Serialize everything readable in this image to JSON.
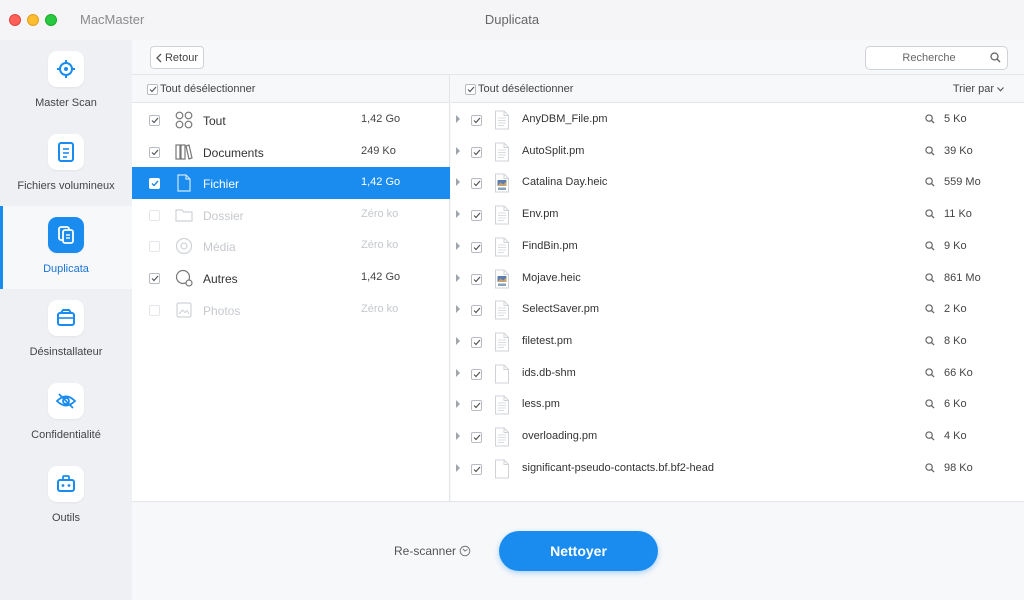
{
  "window": {
    "app_name": "MacMaster",
    "title": "Duplicata"
  },
  "colors": {
    "accent": "#1a8cf0",
    "sidebar_bg": "#eef0f4",
    "traffic_red": "#fe5f57",
    "traffic_yellow": "#febc2e",
    "traffic_green": "#28c840"
  },
  "sidebar": {
    "items": [
      {
        "label": "Master Scan",
        "icon": "target-icon",
        "active": false
      },
      {
        "label": "Fichiers volumineux",
        "icon": "document-icon",
        "active": false
      },
      {
        "label": "Duplicata",
        "icon": "copy-icon",
        "active": true
      },
      {
        "label": "Désinstallateur",
        "icon": "box-icon",
        "active": false
      },
      {
        "label": "Confidentialité",
        "icon": "eye-slash-icon",
        "active": false
      },
      {
        "label": "Outils",
        "icon": "toolbox-icon",
        "active": false
      }
    ]
  },
  "toolbar": {
    "back_label": "Retour",
    "search_placeholder": "Recherche"
  },
  "left_panel": {
    "header_label": "Tout désélectionner",
    "categories": [
      {
        "label": "Tout",
        "size": "1,42 Go",
        "checked": true,
        "enabled": true,
        "active": false,
        "icon": "grid-icon"
      },
      {
        "label": "Documents",
        "size": "249 Ko",
        "checked": true,
        "enabled": true,
        "active": false,
        "icon": "books-icon"
      },
      {
        "label": "Fichier",
        "size": "1,42 Go",
        "checked": true,
        "enabled": true,
        "active": true,
        "icon": "file-icon"
      },
      {
        "label": "Dossier",
        "size": "Zéro ko",
        "checked": false,
        "enabled": false,
        "active": false,
        "icon": "folder-icon"
      },
      {
        "label": "Média",
        "size": "Zéro ko",
        "checked": false,
        "enabled": false,
        "active": false,
        "icon": "media-icon"
      },
      {
        "label": "Autres",
        "size": "1,42 Go",
        "checked": true,
        "enabled": true,
        "active": false,
        "icon": "others-icon"
      },
      {
        "label": "Photos",
        "size": "Zéro ko",
        "checked": false,
        "enabled": false,
        "active": false,
        "icon": "photo-icon"
      }
    ]
  },
  "right_panel": {
    "header_label": "Tout désélectionner",
    "sort_label": "Trier par",
    "files": [
      {
        "name": "AnyDBM_File.pm",
        "size": "5 Ko",
        "icon": "text-file-icon"
      },
      {
        "name": "AutoSplit.pm",
        "size": "39 Ko",
        "icon": "text-file-icon"
      },
      {
        "name": "Catalina Day.heic",
        "size": "559 Mo",
        "icon": "heic-file-icon"
      },
      {
        "name": "Env.pm",
        "size": "11 Ko",
        "icon": "text-file-icon"
      },
      {
        "name": "FindBin.pm",
        "size": "9 Ko",
        "icon": "text-file-icon"
      },
      {
        "name": "Mojave.heic",
        "size": "861 Mo",
        "icon": "heic-file-icon"
      },
      {
        "name": "SelectSaver.pm",
        "size": "2 Ko",
        "icon": "text-file-icon"
      },
      {
        "name": "filetest.pm",
        "size": "8 Ko",
        "icon": "text-file-icon"
      },
      {
        "name": "ids.db-shm",
        "size": "66 Ko",
        "icon": "blank-file-icon"
      },
      {
        "name": "less.pm",
        "size": "6 Ko",
        "icon": "text-file-icon"
      },
      {
        "name": "overloading.pm",
        "size": "4 Ko",
        "icon": "text-file-icon"
      },
      {
        "name": "significant-pseudo-contacts.bf.bf2-head",
        "size": "98 Ko",
        "icon": "blank-file-icon"
      }
    ]
  },
  "bottom": {
    "rescan_label": "Re-scanner",
    "clean_label": "Nettoyer"
  }
}
